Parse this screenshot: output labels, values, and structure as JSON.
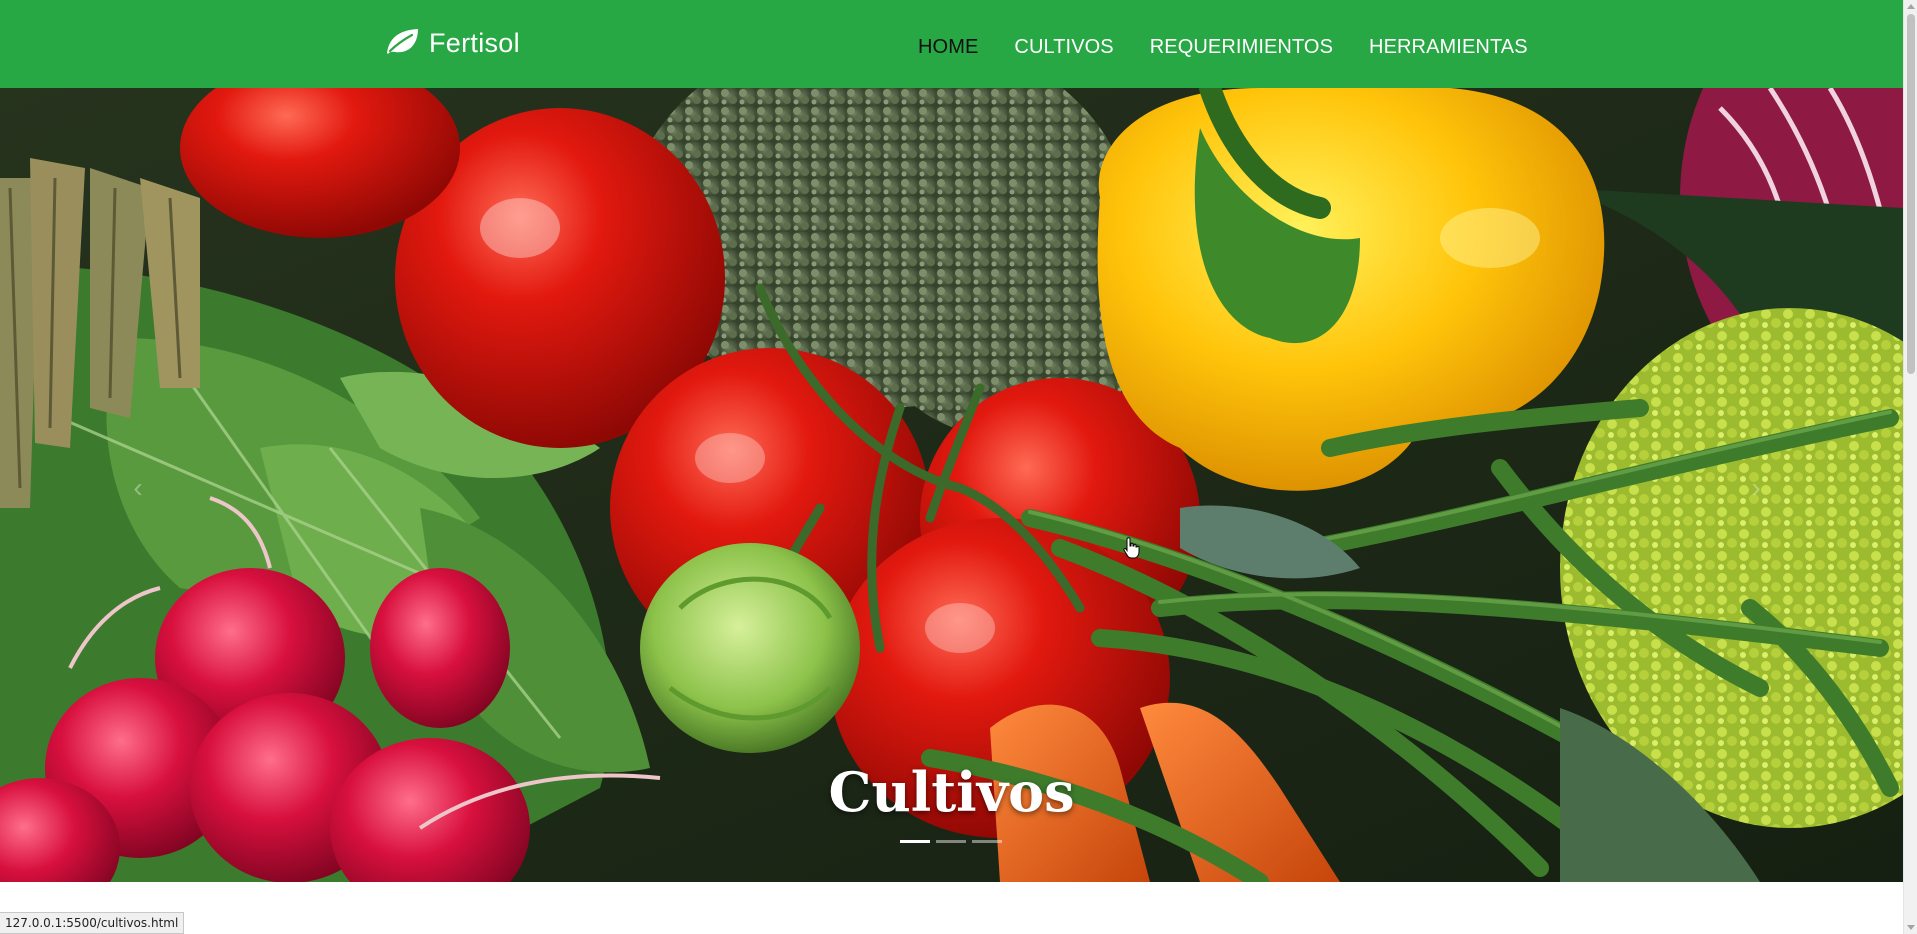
{
  "navbar": {
    "brand": {
      "name": "Fertisol",
      "icon": "leaf-icon"
    },
    "links": [
      {
        "label": "HOME",
        "active": true
      },
      {
        "label": "CULTIVOS",
        "active": false
      },
      {
        "label": "REQUERIMIENTOS",
        "active": false
      },
      {
        "label": "HERRAMIENTAS",
        "active": false
      }
    ],
    "color": "#28a745"
  },
  "carousel": {
    "caption": "Cultivos",
    "slide_count": 3,
    "active_index": 0,
    "image": "vegetables-photo"
  },
  "statusbar": {
    "url": "127.0.0.1:5500/cultivos.html"
  }
}
